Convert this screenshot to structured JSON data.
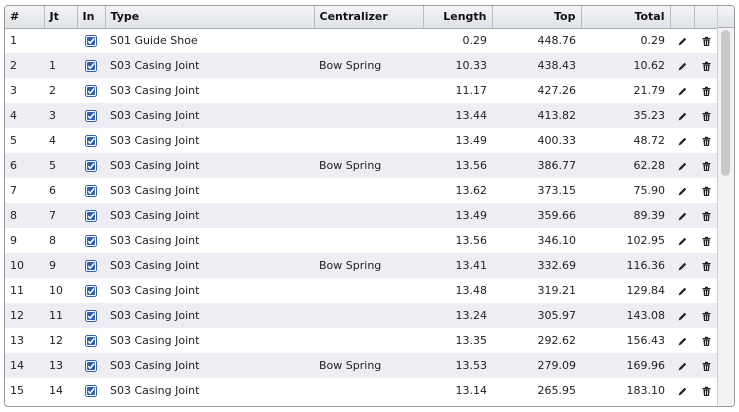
{
  "columns": {
    "num": "#",
    "jt": "Jt",
    "in": "In",
    "type": "Type",
    "centralizer": "Centralizer",
    "length": "Length",
    "top": "Top",
    "total": "Total"
  },
  "rows": [
    {
      "num": "1",
      "jt": "",
      "checked": true,
      "type": "S01 Guide Shoe",
      "centralizer": "",
      "length": "0.29",
      "top": "448.76",
      "total": "0.29"
    },
    {
      "num": "2",
      "jt": "1",
      "checked": true,
      "type": "S03 Casing Joint",
      "centralizer": "Bow Spring",
      "length": "10.33",
      "top": "438.43",
      "total": "10.62"
    },
    {
      "num": "3",
      "jt": "2",
      "checked": true,
      "type": "S03 Casing Joint",
      "centralizer": "",
      "length": "11.17",
      "top": "427.26",
      "total": "21.79"
    },
    {
      "num": "4",
      "jt": "3",
      "checked": true,
      "type": "S03 Casing Joint",
      "centralizer": "",
      "length": "13.44",
      "top": "413.82",
      "total": "35.23"
    },
    {
      "num": "5",
      "jt": "4",
      "checked": true,
      "type": "S03 Casing Joint",
      "centralizer": "",
      "length": "13.49",
      "top": "400.33",
      "total": "48.72"
    },
    {
      "num": "6",
      "jt": "5",
      "checked": true,
      "type": "S03 Casing Joint",
      "centralizer": "Bow Spring",
      "length": "13.56",
      "top": "386.77",
      "total": "62.28"
    },
    {
      "num": "7",
      "jt": "6",
      "checked": true,
      "type": "S03 Casing Joint",
      "centralizer": "",
      "length": "13.62",
      "top": "373.15",
      "total": "75.90"
    },
    {
      "num": "8",
      "jt": "7",
      "checked": true,
      "type": "S03 Casing Joint",
      "centralizer": "",
      "length": "13.49",
      "top": "359.66",
      "total": "89.39"
    },
    {
      "num": "9",
      "jt": "8",
      "checked": true,
      "type": "S03 Casing Joint",
      "centralizer": "",
      "length": "13.56",
      "top": "346.10",
      "total": "102.95"
    },
    {
      "num": "10",
      "jt": "9",
      "checked": true,
      "type": "S03 Casing Joint",
      "centralizer": "Bow Spring",
      "length": "13.41",
      "top": "332.69",
      "total": "116.36"
    },
    {
      "num": "11",
      "jt": "10",
      "checked": true,
      "type": "S03 Casing Joint",
      "centralizer": "",
      "length": "13.48",
      "top": "319.21",
      "total": "129.84"
    },
    {
      "num": "12",
      "jt": "11",
      "checked": true,
      "type": "S03 Casing Joint",
      "centralizer": "",
      "length": "13.24",
      "top": "305.97",
      "total": "143.08"
    },
    {
      "num": "13",
      "jt": "12",
      "checked": true,
      "type": "S03 Casing Joint",
      "centralizer": "",
      "length": "13.35",
      "top": "292.62",
      "total": "156.43"
    },
    {
      "num": "14",
      "jt": "13",
      "checked": true,
      "type": "S03 Casing Joint",
      "centralizer": "Bow Spring",
      "length": "13.53",
      "top": "279.09",
      "total": "169.96"
    },
    {
      "num": "15",
      "jt": "14",
      "checked": true,
      "type": "S03 Casing Joint",
      "centralizer": "",
      "length": "13.14",
      "top": "265.95",
      "total": "183.10"
    }
  ],
  "icons": {
    "edit": "pencil-icon",
    "delete": "trash-icon",
    "checkbox": "checkbox-checked-icon"
  },
  "colors": {
    "accent": "#2f5fa8",
    "row_alt": "#eeedf3",
    "header": "#dfe2e6"
  }
}
